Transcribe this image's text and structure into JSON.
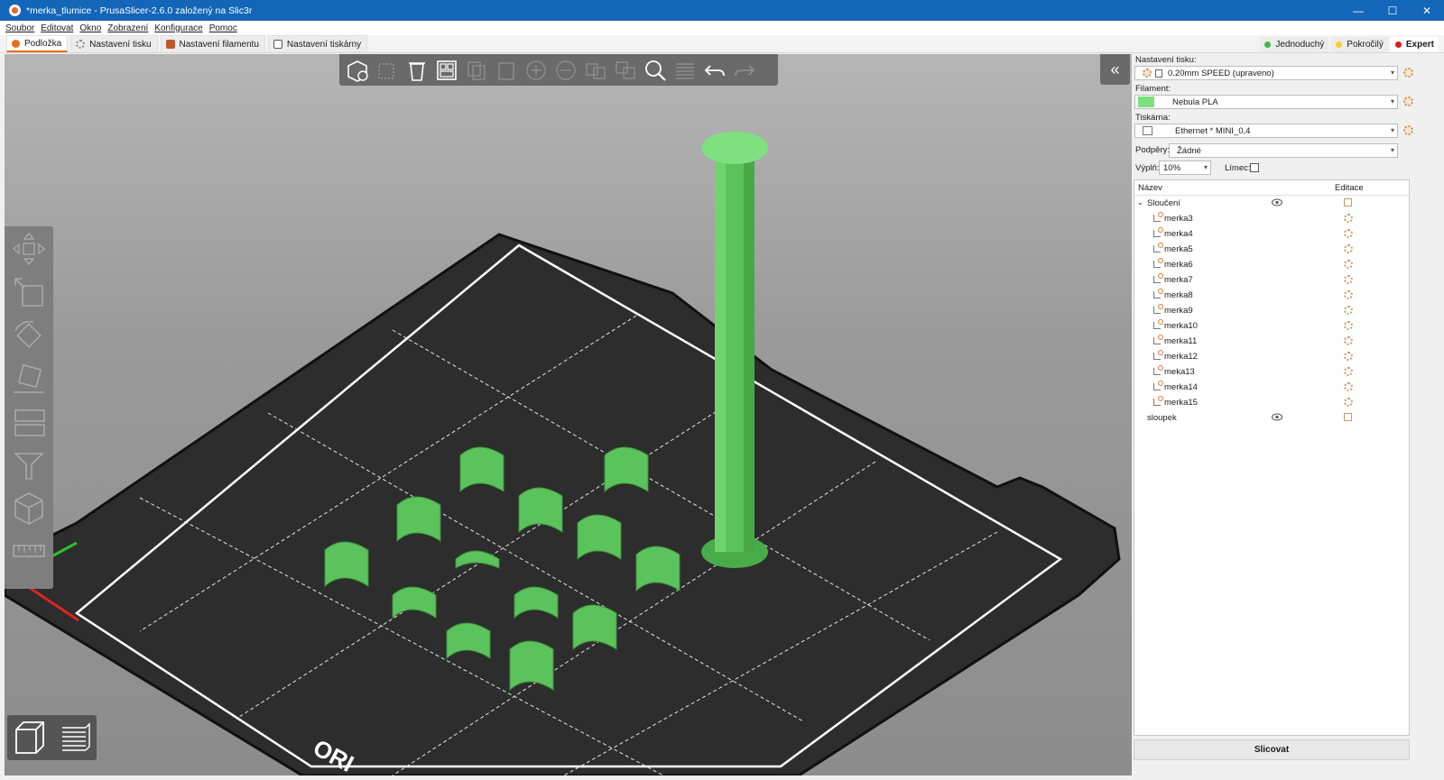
{
  "window": {
    "title": "*merka_tlumice - PrusaSlicer-2.6.0 založený na Slic3r",
    "minimize": "—",
    "maximize": "☐",
    "close": "✕"
  },
  "menu": [
    "Soubor",
    "Editovat",
    "Okno",
    "Zobrazení",
    "Konfigurace",
    "Pomoc"
  ],
  "tabs": [
    {
      "label": "Podložka",
      "active": true
    },
    {
      "label": "Nastavení tisku",
      "active": false
    },
    {
      "label": "Nastavení filamentu",
      "active": false
    },
    {
      "label": "Nastavení tiskárny",
      "active": false
    }
  ],
  "modes": [
    {
      "label": "Jednoduchý",
      "color": "#3fb93f",
      "active": false
    },
    {
      "label": "Pokročilý",
      "color": "#f3d22a",
      "active": false
    },
    {
      "label": "Expert",
      "color": "#e01b1b",
      "active": true
    }
  ],
  "sidebar": {
    "print_label": "Nastavení tisku:",
    "print_value": "0.20mm SPEED (upraveno)",
    "filament_label": "Filament:",
    "filament_value": "Nebula PLA",
    "filament_color": "#7ee07e",
    "printer_label": "Tiskárna:",
    "printer_value": "Ethernet * MINI_0,4",
    "supports_label": "Podpěry:",
    "supports_value": "Žádné",
    "infill_label": "Výplň:",
    "infill_value": "10%",
    "brim_label": "Límec:",
    "col_name": "Název",
    "col_edit": "Editace",
    "group_name": "Sloučení",
    "parts": [
      "merka3",
      "merka4",
      "merka5",
      "merka6",
      "merka7",
      "merka8",
      "merka9",
      "merka10",
      "merka11",
      "merka12",
      "meka13",
      "merka14",
      "merka15"
    ],
    "second_object": "sloupek",
    "slice_button": "Slicovat"
  },
  "bed": {
    "label": "ORI",
    "model_color": "#5bc35b"
  }
}
